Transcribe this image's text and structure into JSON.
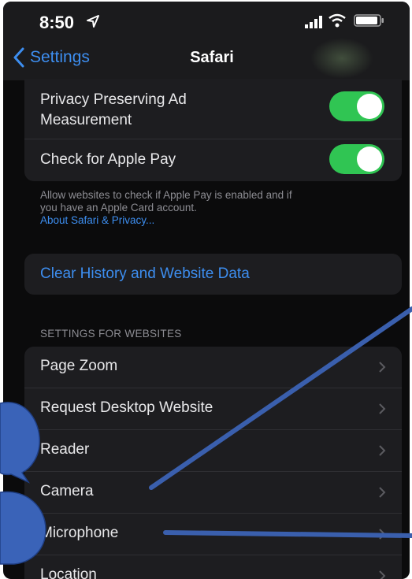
{
  "status_bar": {
    "time": "8:50"
  },
  "nav": {
    "back_label": "Settings",
    "title": "Safari"
  },
  "privacy_group": {
    "items": [
      {
        "label_line1": "Privacy Preserving Ad",
        "label_line2": "Measurement",
        "toggle": "on"
      },
      {
        "label": "Check for Apple Pay",
        "toggle": "on"
      }
    ]
  },
  "footnote": {
    "line1": "Allow websites to check if Apple Pay is enabled and if",
    "line2": "you have an Apple Card account.",
    "link": "About Safari & Privacy..."
  },
  "clear_history": {
    "label": "Clear History and Website Data"
  },
  "websites_section": {
    "header": "SETTINGS FOR WEBSITES",
    "items": [
      {
        "label": "Page Zoom"
      },
      {
        "label": "Request Desktop Website"
      },
      {
        "label": "Reader"
      },
      {
        "label": "Camera"
      },
      {
        "label": "Microphone"
      },
      {
        "label": "Location"
      }
    ]
  },
  "colors": {
    "accent": "#3d8ef0",
    "toggle_on": "#30c553",
    "annotation": "#3a5fad"
  }
}
